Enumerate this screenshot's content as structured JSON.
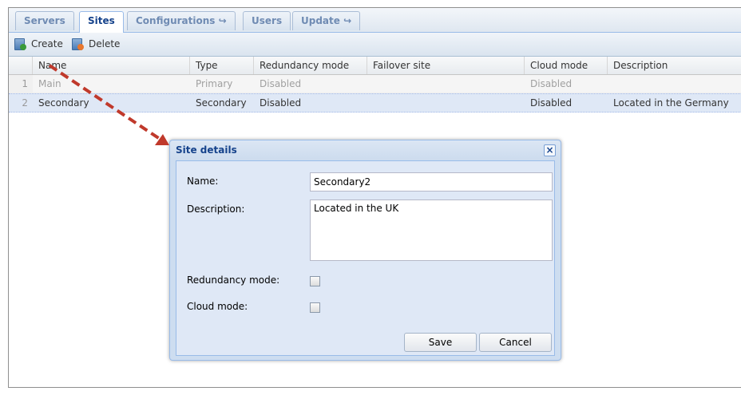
{
  "tabs": [
    {
      "label": "Servers",
      "active": false
    },
    {
      "label": "Sites",
      "active": true
    },
    {
      "label": "Configurations ↪",
      "active": false
    },
    {
      "label": "Users",
      "active": false
    },
    {
      "label": "Update ↪",
      "active": false
    }
  ],
  "toolbar": {
    "create_label": "Create",
    "delete_label": "Delete",
    "create_icon": "add-document-icon",
    "delete_icon": "delete-document-icon"
  },
  "grid": {
    "columns": [
      "Name",
      "Type",
      "Redundancy mode",
      "Failover site",
      "Cloud mode",
      "Description"
    ],
    "rows": [
      {
        "num": "1",
        "name": "Main",
        "type": "Primary",
        "redundancy": "Disabled",
        "failover": "",
        "cloud": "Disabled",
        "description": ""
      },
      {
        "num": "2",
        "name": "Secondary",
        "type": "Secondary",
        "redundancy": "Disabled",
        "failover": "",
        "cloud": "Disabled",
        "description": "Located in the Germany"
      }
    ]
  },
  "dialog": {
    "title": "Site details",
    "name_label": "Name:",
    "name_value": "Secondary2",
    "description_label": "Description:",
    "description_value": "Located in the UK",
    "redundancy_label": "Redundancy mode:",
    "redundancy_checked": false,
    "cloud_label": "Cloud mode:",
    "cloud_checked": false,
    "save_label": "Save",
    "cancel_label": "Cancel",
    "close_icon": "close-icon"
  },
  "colors": {
    "accent": "#15428b",
    "selected_row": "#dfe8f6",
    "annotation_arrow": "#c0392b",
    "create_dot": "#3a9a3a",
    "delete_dot": "#e8772e"
  }
}
